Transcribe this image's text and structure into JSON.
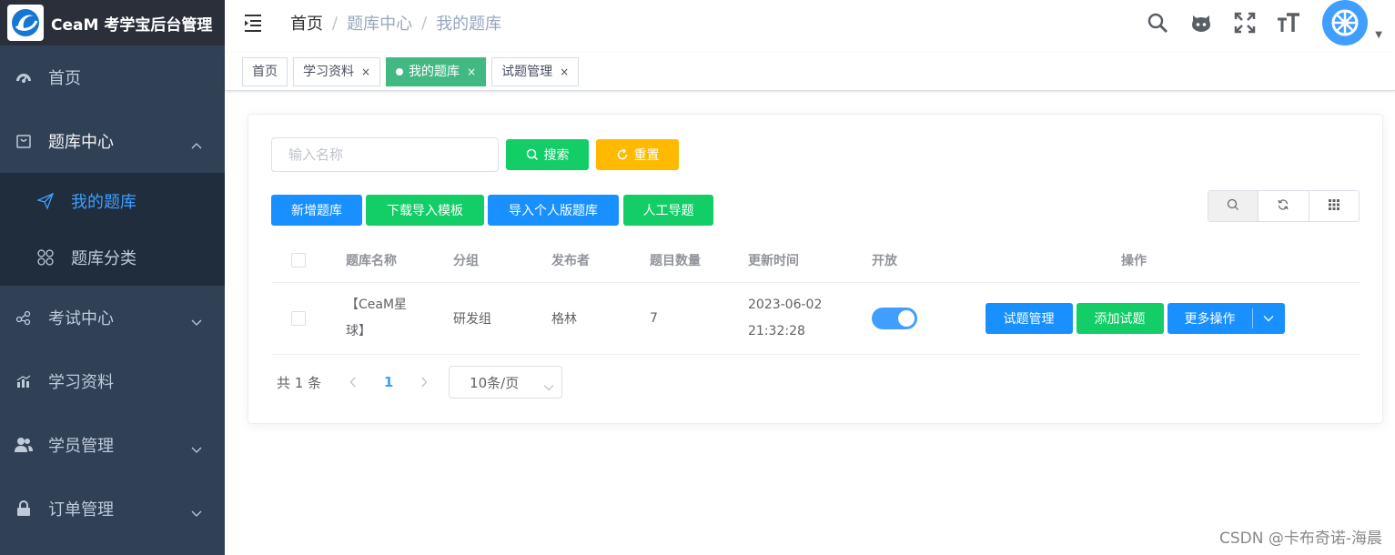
{
  "app": {
    "title": "CeaM 考学宝后台管理"
  },
  "sidebar": {
    "items": [
      {
        "label": "首页",
        "icon": "dashboard-icon"
      },
      {
        "label": "题库中心",
        "icon": "shopping-bag-icon",
        "expanded": true,
        "children": [
          {
            "label": "我的题库",
            "icon": "send-icon",
            "active": true
          },
          {
            "label": "题库分类",
            "icon": "grid-icon"
          }
        ]
      },
      {
        "label": "考试中心",
        "icon": "share-icon"
      },
      {
        "label": "学习资料",
        "icon": "chart-icon"
      },
      {
        "label": "学员管理",
        "icon": "users-icon"
      },
      {
        "label": "订单管理",
        "icon": "lock-icon"
      }
    ]
  },
  "breadcrumb": [
    "首页",
    "题库中心",
    "我的题库"
  ],
  "tags": [
    {
      "label": "首页",
      "closable": false,
      "active": false
    },
    {
      "label": "学习资料",
      "closable": true,
      "active": false
    },
    {
      "label": "我的题库",
      "closable": true,
      "active": true
    },
    {
      "label": "试题管理",
      "closable": true,
      "active": false
    }
  ],
  "search": {
    "placeholder": "输入名称",
    "value": "",
    "search_label": "搜索",
    "reset_label": "重置"
  },
  "actions": {
    "add": "新增题库",
    "download": "下载导入模板",
    "import": "导入个人版题库",
    "manual": "人工导题"
  },
  "table": {
    "headers": {
      "name": "题库名称",
      "group": "分组",
      "publisher": "发布者",
      "count": "题目数量",
      "updated": "更新时间",
      "open": "开放",
      "ops": "操作"
    },
    "rows": [
      {
        "name_line1": "【CeaM星",
        "name_line2": "球】",
        "group": "研发组",
        "publisher": "格林",
        "count": "7",
        "date": "2023-06-02",
        "time": "21:32:28",
        "open": true,
        "ops": {
          "manage": "试题管理",
          "add": "添加试题",
          "more": "更多操作"
        }
      }
    ]
  },
  "pagination": {
    "total": "共 1 条",
    "current": "1",
    "page_size": "10条/页"
  },
  "watermark": "CSDN @卡布奇诺-海晨",
  "colors": {
    "sidebar_bg": "#304156",
    "active_blue": "#409eff",
    "green": "#13ce66",
    "yellow": "#ffba00",
    "blue": "#1890ff",
    "tag_active": "#42b983"
  }
}
